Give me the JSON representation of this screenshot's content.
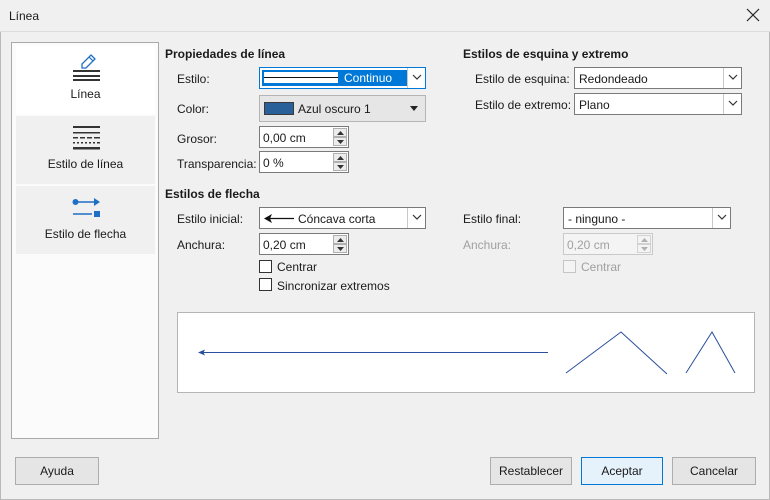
{
  "window": {
    "title": "Línea"
  },
  "sidebar": {
    "items": [
      {
        "label": "Línea",
        "icon": "pencil-line-icon"
      },
      {
        "label": "Estilo de línea",
        "icon": "line-style-icon"
      },
      {
        "label": "Estilo de flecha",
        "icon": "arrow-style-icon"
      }
    ]
  },
  "line_props": {
    "header": "Propiedades de línea",
    "style_label": "Estilo:",
    "style_value": "Continuo",
    "color_label": "Color:",
    "color_value": "Azul oscuro 1",
    "color_swatch": "#2a6099",
    "width_label": "Grosor:",
    "width_value": "0,00 cm",
    "transparency_label": "Transparencia:",
    "transparency_value": "0 %"
  },
  "corner": {
    "header": "Estilos de esquina y extremo",
    "corner_label": "Estilo de esquina:",
    "corner_value": "Redondeado",
    "cap_label": "Estilo de extremo:",
    "cap_value": "Plano"
  },
  "arrows": {
    "header": "Estilos de flecha",
    "start_label": "Estilo inicial:",
    "start_value": "Cóncava corta",
    "end_label": "Estilo final:",
    "end_value": "- ninguno -",
    "start_width_label": "Anchura:",
    "start_width_value": "0,20 cm",
    "end_width_label": "Anchura:",
    "end_width_value": "0,20 cm",
    "center_start_label": "Centrar",
    "center_end_label": "Centrar",
    "sync_label": "Sincronizar extremos"
  },
  "buttons": {
    "help": "Ayuda",
    "reset": "Restablecer",
    "ok": "Aceptar",
    "cancel": "Cancelar"
  },
  "colors": {
    "accent": "#0078d7",
    "preview_line": "#2a4f9e",
    "selection": "#0078d7"
  }
}
